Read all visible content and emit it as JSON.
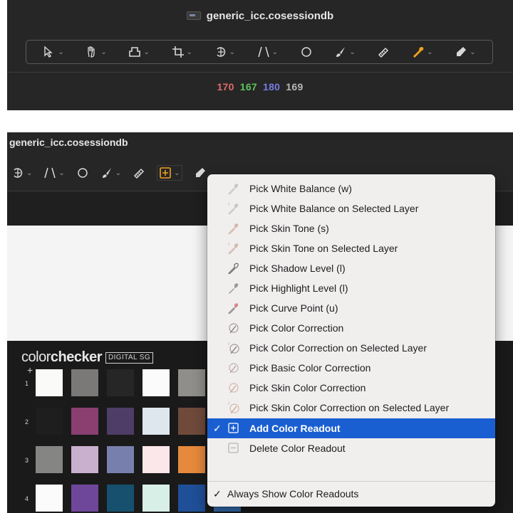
{
  "top": {
    "title": "generic_icc.cosessiondb",
    "tools": [
      {
        "icon": "pointer-icon",
        "dropdown": "⌄"
      },
      {
        "icon": "hand-icon",
        "dropdown": "⌄"
      },
      {
        "icon": "stamp-icon",
        "dropdown": "⌄"
      },
      {
        "icon": "crop-icon",
        "dropdown": "⌄"
      },
      {
        "icon": "rotate-icon",
        "dropdown": "⌄"
      },
      {
        "icon": "keystone-icon",
        "dropdown": "⌄"
      },
      {
        "icon": "circle-icon",
        "dropdown": ""
      },
      {
        "icon": "brush-icon",
        "dropdown": "⌄"
      },
      {
        "icon": "eraser-icon",
        "dropdown": ""
      },
      {
        "icon": "picker-icon",
        "dropdown": "⌄"
      },
      {
        "icon": "annotate-icon",
        "dropdown": "⌄"
      }
    ],
    "readout": {
      "r": "170",
      "g": "167",
      "b": "180",
      "l": "169"
    }
  },
  "bottom": {
    "title": "generic_icc.cosessiondb",
    "tools": [
      {
        "icon": "rotate-icon",
        "dropdown": "⌄"
      },
      {
        "icon": "keystone-icon",
        "dropdown": "⌄"
      },
      {
        "icon": "circle-icon",
        "dropdown": ""
      },
      {
        "icon": "brush-icon",
        "dropdown": "⌄"
      },
      {
        "icon": "eraser-icon",
        "dropdown": ""
      },
      {
        "icon": "color-readout-icon",
        "dropdown": "⌄"
      },
      {
        "icon": "annotate-icon",
        "dropdown": ""
      }
    ],
    "checker": {
      "brand_light": "color",
      "brand_bold": "checker",
      "badge": "DIGITAL SG",
      "rows": [
        "1",
        "2",
        "3",
        "4"
      ],
      "swatches": [
        [
          "#fafaf8",
          "#7b7977",
          "#262626",
          "#fbfbfb",
          "#8f8e8b",
          "#cfcdca"
        ],
        [
          "#1e1e1e",
          "#8a3f70",
          "#4e3d66",
          "#dfe7ee",
          "#6f4a3b",
          "#b88a60"
        ],
        [
          "#858684",
          "#c9b0cf",
          "#7780ad",
          "#fbe6e9",
          "#e7893c",
          "#d69a5a"
        ],
        [
          "#fbfbfb",
          "#6f479a",
          "#16506e",
          "#d8efe7",
          "#1f4f98",
          "#3672b5"
        ]
      ]
    }
  },
  "menu": {
    "items": [
      {
        "label": "Pick White Balance (w)",
        "icon": "white-balance-picker-icon",
        "state": "disabled"
      },
      {
        "label": "Pick White Balance on Selected Layer",
        "icon": "white-balance-layer-picker-icon",
        "state": "disabled"
      },
      {
        "label": "Pick Skin Tone (s)",
        "icon": "skin-tone-picker-icon",
        "state": "disabled"
      },
      {
        "label": "Pick Skin Tone on Selected Layer",
        "icon": "skin-tone-layer-picker-icon",
        "state": "disabled"
      },
      {
        "label": "Pick Shadow Level (l)",
        "icon": "shadow-picker-icon",
        "state": "normal"
      },
      {
        "label": "Pick Highlight Level (l)",
        "icon": "highlight-picker-icon",
        "state": "normal"
      },
      {
        "label": "Pick Curve Point (u)",
        "icon": "curve-point-picker-icon",
        "state": "normal"
      },
      {
        "label": "Pick Color Correction",
        "icon": "color-correction-picker-icon",
        "state": "normal"
      },
      {
        "label": "Pick Color Correction on Selected Layer",
        "icon": "color-correction-layer-picker-icon",
        "state": "normal"
      },
      {
        "label": "Pick Basic Color Correction",
        "icon": "basic-color-correction-picker-icon",
        "state": "normal"
      },
      {
        "label": "Pick Skin Color Correction",
        "icon": "skin-color-correction-picker-icon",
        "state": "normal"
      },
      {
        "label": "Pick Skin Color Correction on Selected Layer",
        "icon": "skin-color-correction-layer-picker-icon",
        "state": "normal"
      },
      {
        "label": "Add Color Readout",
        "icon": "add-color-readout-icon",
        "state": "selected",
        "check": "✓"
      },
      {
        "label": "Delete Color Readout",
        "icon": "delete-color-readout-icon",
        "state": "normal"
      }
    ],
    "footer": {
      "label": "Always Show Color Readouts",
      "check": "✓"
    }
  },
  "colors": {
    "readout_r": "#e06a6a",
    "readout_g": "#5fc25f",
    "readout_b": "#7a7ae0",
    "readout_l": "#b8b8b8",
    "active_tool": "#f0a020",
    "menu_selected": "#1a5fd1"
  }
}
